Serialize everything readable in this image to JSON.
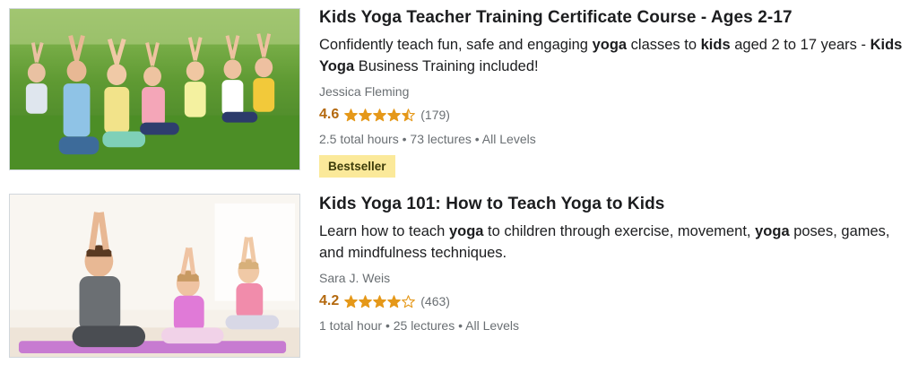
{
  "courses": [
    {
      "title": "Kids Yoga Teacher Training Certificate Course - Ages 2-17",
      "description": [
        {
          "text": "Confidently teach fun, safe and engaging ",
          "bold": false
        },
        {
          "text": "yoga",
          "bold": true
        },
        {
          "text": " classes to ",
          "bold": false
        },
        {
          "text": "kids",
          "bold": true
        },
        {
          "text": " aged 2 to 17 years - ",
          "bold": false
        },
        {
          "text": "Kids Yoga",
          "bold": true
        },
        {
          "text": " Business Training included!",
          "bold": false
        }
      ],
      "author": "Jessica Fleming",
      "rating": "4.6",
      "rating_value": 4.6,
      "rating_count": "(179)",
      "meta": "2.5 total hours • 73 lectures • All Levels",
      "badge": "Bestseller"
    },
    {
      "title": "Kids Yoga 101: How to Teach Yoga to Kids",
      "description": [
        {
          "text": "Learn how to teach ",
          "bold": false
        },
        {
          "text": "yoga",
          "bold": true
        },
        {
          "text": " to children through exercise, movement, ",
          "bold": false
        },
        {
          "text": "yoga",
          "bold": true
        },
        {
          "text": " poses, games, and mindfulness techniques.",
          "bold": false
        }
      ],
      "author": "Sara J. Weis",
      "rating": "4.2",
      "rating_value": 4.2,
      "rating_count": "(463)",
      "meta": "1 total hour • 25 lectures • All Levels",
      "badge": ""
    }
  ],
  "colors": {
    "rating": "#b4690e",
    "star_fill": "#e59819",
    "badge_bg": "#fbe99a",
    "muted_text": "#6a6f73"
  },
  "icons": [
    "star-full-icon",
    "star-half-icon",
    "star-empty-icon"
  ]
}
